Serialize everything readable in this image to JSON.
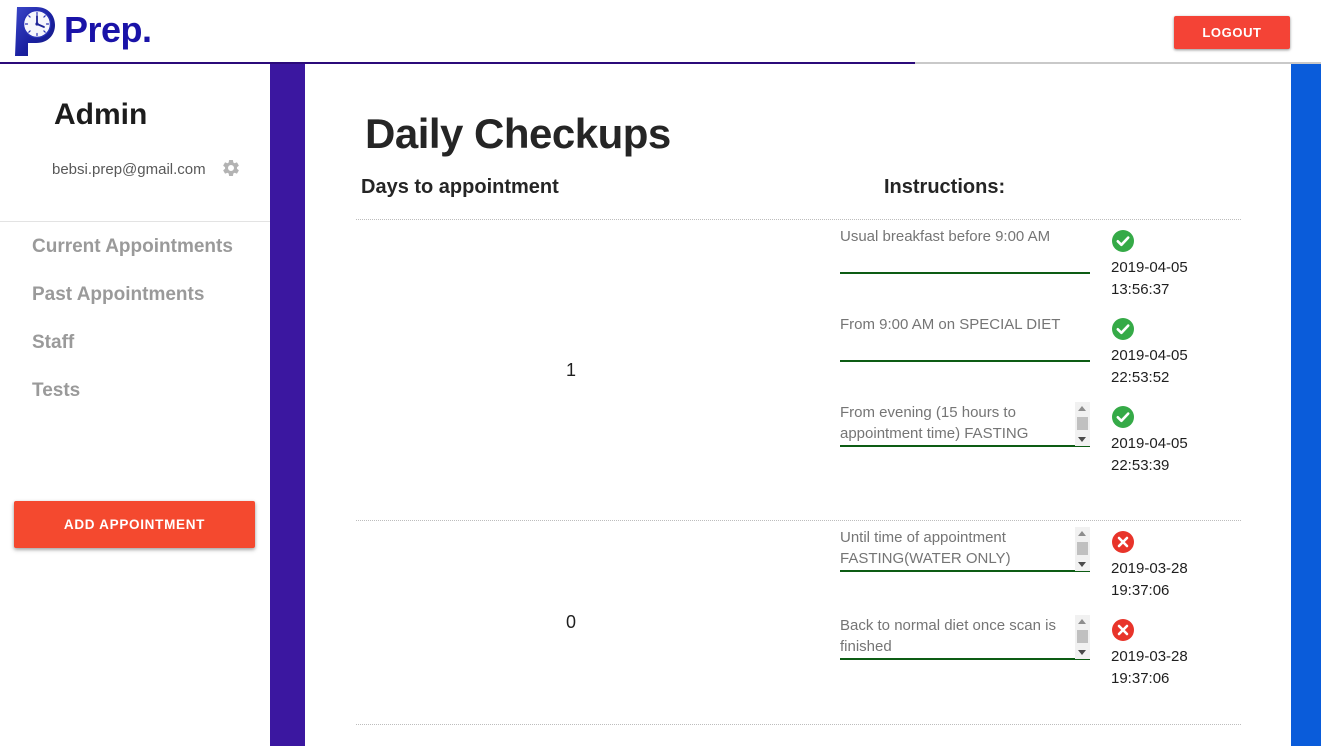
{
  "brand": {
    "name": "Prep.",
    "logo_icon": "clock-p-logo-icon",
    "logo_color": "#1a13a8"
  },
  "topbar": {
    "logout_label": "LOGOUT",
    "logout_color": "#f44336"
  },
  "sidebar": {
    "profile": {
      "name": "Admin",
      "email": "bebsi.prep@gmail.com",
      "settings_icon": "gear-icon"
    },
    "items": [
      {
        "label": "Current Appointments"
      },
      {
        "label": "Past Appointments"
      },
      {
        "label": "Staff"
      },
      {
        "label": "Tests"
      }
    ],
    "add_appointment_label": "ADD APPOINTMENT",
    "add_appointment_color": "#f4492f",
    "accent_strip_color": "#3b17a0"
  },
  "right_accent_color": "#0a5cda",
  "main": {
    "page_title": "Daily Checkups",
    "columns": {
      "days": "Days to appointment",
      "instructions": "Instructions:"
    },
    "rows": [
      {
        "days": "1",
        "instructions": [
          {
            "text": "Usual breakfast before 9:00 AM",
            "scrollable": false,
            "status": "done",
            "status_icon": "check-circle-icon",
            "timestamp": "2019-04-05\n13:56:37"
          },
          {
            "text": "From 9:00 AM on SPECIAL DIET",
            "scrollable": false,
            "status": "done",
            "status_icon": "check-circle-icon",
            "timestamp": "2019-04-05\n22:53:52"
          },
          {
            "text": "From evening (15 hours to appointment time) FASTING",
            "scrollable": true,
            "status": "done",
            "status_icon": "check-circle-icon",
            "timestamp": "2019-04-05\n22:53:39"
          }
        ]
      },
      {
        "days": "0",
        "instructions": [
          {
            "text": "Until time of appointment FASTING(WATER ONLY)",
            "scrollable": true,
            "status": "not-done",
            "status_icon": "x-circle-icon",
            "timestamp": "2019-03-28\n19:37:06"
          },
          {
            "text": "Back to normal diet once scan is finished",
            "scrollable": true,
            "status": "not-done",
            "status_icon": "x-circle-icon",
            "timestamp": "2019-03-28\n19:37:06"
          }
        ]
      }
    ],
    "status_colors": {
      "done": "#35aa47",
      "not_done": "#e8342a"
    },
    "field_underline_color": "#0d5c14"
  }
}
